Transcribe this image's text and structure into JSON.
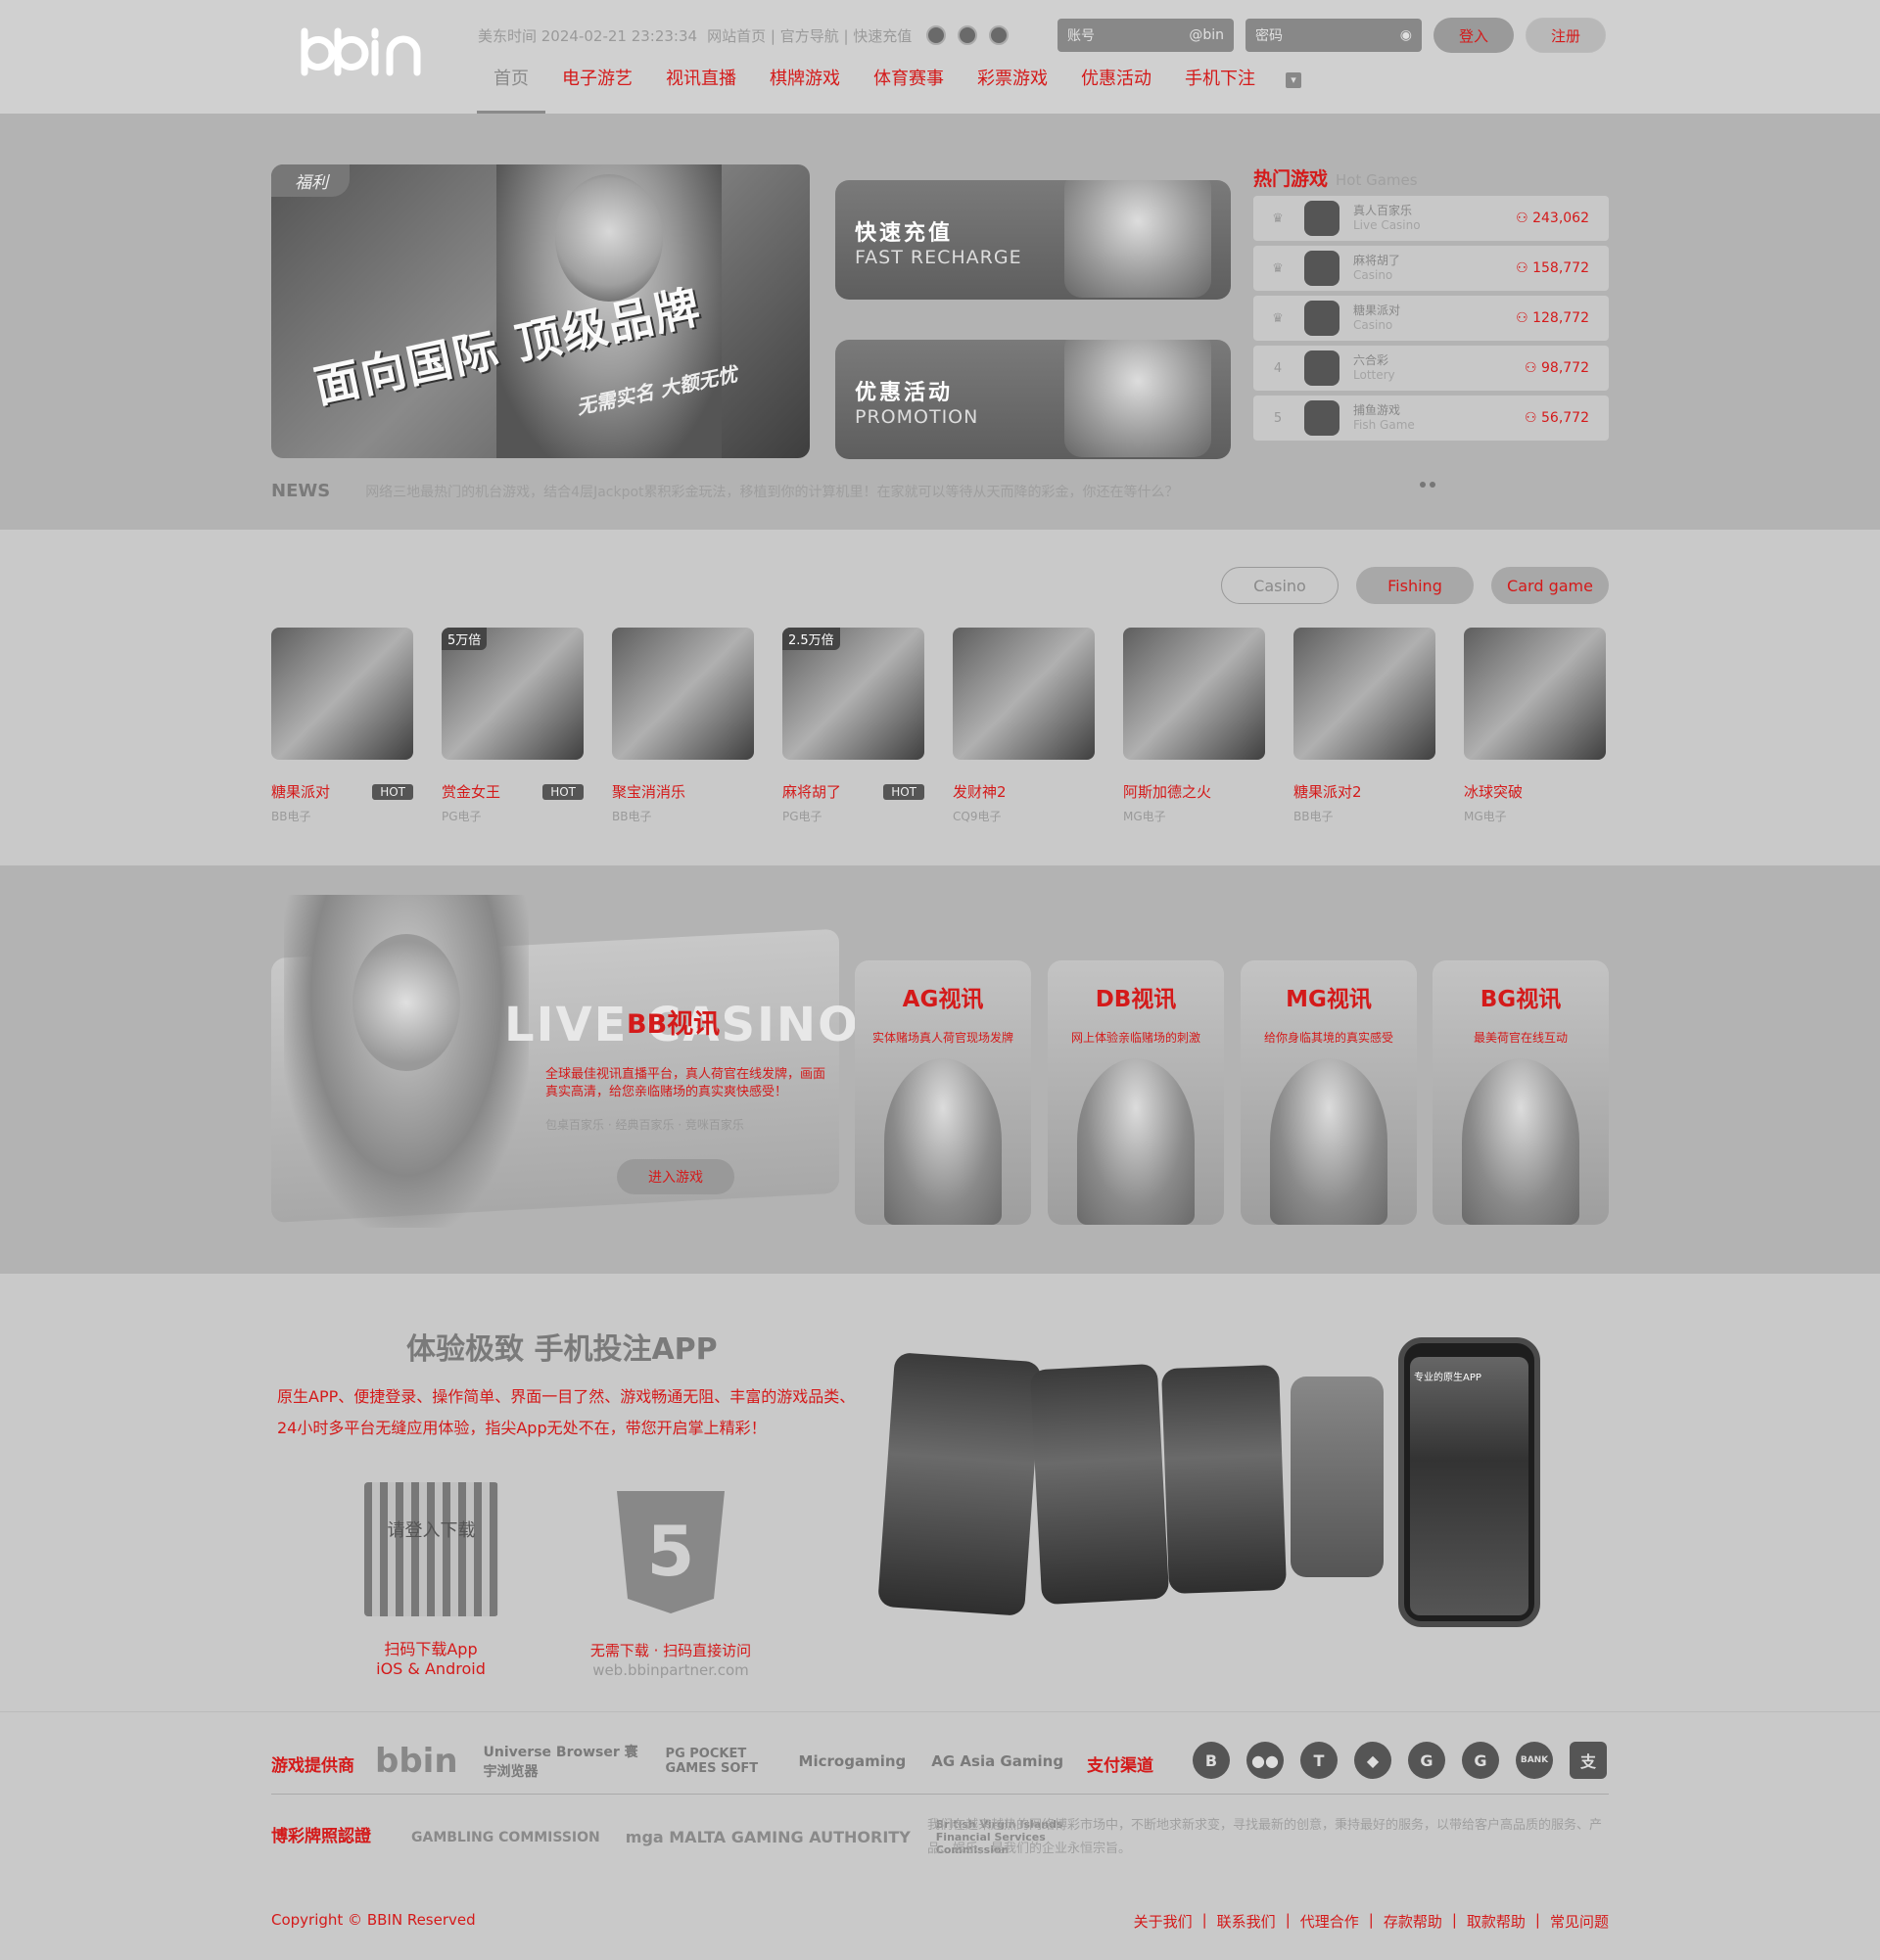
{
  "header": {
    "logo": "bbin",
    "datetime": "美东时间 2024-02-21 23:23:34",
    "links": [
      "网站首页",
      "官方导航",
      "快速充值"
    ],
    "flag_icons": [
      "flag-cn-icon",
      "flag-hk-icon",
      "flag-us-icon"
    ],
    "account_placeholder": "账号",
    "account_suffix": "@bin",
    "password_placeholder": "密码",
    "login_label": "登入",
    "register_label": "注册",
    "nav": [
      "首页",
      "电子游艺",
      "视讯直播",
      "棋牌游戏",
      "体育赛事",
      "彩票游戏",
      "优惠活动",
      "手机下注"
    ]
  },
  "hero": {
    "banner": {
      "tag": "福利",
      "title": "面向国际 顶级品牌",
      "subtitle": "无需实名 大额无忧"
    },
    "cards": [
      {
        "cn": "快速充值",
        "en": "FAST RECHARGE"
      },
      {
        "cn": "优惠活动",
        "en": "PROMOTION"
      }
    ],
    "hot_games": {
      "title": "热门游戏",
      "title_en": "Hot Games",
      "items": [
        {
          "rank": "1",
          "name": "真人百家乐",
          "category": "Live Casino",
          "count": "243,062"
        },
        {
          "rank": "2",
          "name": "麻将胡了",
          "category": "Casino",
          "count": "158,772"
        },
        {
          "rank": "3",
          "name": "糖果派对",
          "category": "Casino",
          "count": "128,772"
        },
        {
          "rank": "4",
          "name": "六合彩",
          "category": "Lottery",
          "count": "98,772"
        },
        {
          "rank": "5",
          "name": "捕鱼游戏",
          "category": "Fish Game",
          "count": "56,772"
        }
      ]
    },
    "news": {
      "label": "NEWS",
      "text": "网络三地最热门的机台游戏，结合4层Jackpot累积彩金玩法，移植到你的计算机里！在家就可以等待从天而降的彩金，你还在等什么？"
    }
  },
  "games": {
    "tabs": [
      "Casino",
      "Fishing",
      "Card game"
    ],
    "items": [
      {
        "name": "糖果派对",
        "provider": "BB电子",
        "badge": "",
        "hot": "HOT"
      },
      {
        "name": "赏金女王",
        "provider": "PG电子",
        "badge": "5万倍",
        "hot": "HOT"
      },
      {
        "name": "聚宝消消乐",
        "provider": "BB电子",
        "badge": "",
        "hot": ""
      },
      {
        "name": "麻将胡了",
        "provider": "PG电子",
        "badge": "2.5万倍",
        "hot": "HOT"
      },
      {
        "name": "发财神2",
        "provider": "CQ9电子",
        "badge": "",
        "hot": ""
      },
      {
        "name": "阿斯加德之火",
        "provider": "MG电子",
        "badge": "",
        "hot": ""
      },
      {
        "name": "糖果派对2",
        "provider": "BB电子",
        "badge": "",
        "hot": ""
      },
      {
        "name": "冰球突破",
        "provider": "MG电子",
        "badge": "",
        "hot": ""
      }
    ]
  },
  "live": {
    "bb": {
      "bg_text": "LIVE CASINO",
      "name": "BB视讯",
      "desc": "全球最佳视讯直播平台，真人荷官在线发牌，画面真实高清，给您亲临赌场的真实爽快感受！",
      "sub": "包桌百家乐 · 经典百家乐 · 竞咪百家乐",
      "button": "进入游戏"
    },
    "vendors": [
      {
        "name": "AG视讯",
        "desc": "实体赌场真人荷官现场发牌"
      },
      {
        "name": "DB视讯",
        "desc": "网上体验亲临赌场的刺激"
      },
      {
        "name": "MG视讯",
        "desc": "给你身临其境的真实感受"
      },
      {
        "name": "BG视讯",
        "desc": "最美荷官在线互动"
      }
    ]
  },
  "app": {
    "title": "体验极致 手机投注APP",
    "desc_1": "原生APP、便捷登录、操作简单、界面一目了然、游戏畅通无阻、丰富的游戏品类、",
    "desc_2": "24小时多平台无缝应用体验，指尖App无处不在，带您开启掌上精彩！",
    "qr_overlay": "请登入下载",
    "qr_label_1": "扫码下载App",
    "qr_label_2": "iOS & Android",
    "h5_label": "无需下载 · 扫码直接访问",
    "h5_url": "web.bbinpartner.com",
    "phone_screen_title": "专业的原生APP"
  },
  "footer": {
    "providers_label": "游戏提供商",
    "providers": [
      "bbin",
      "Universe Browser 寰宇浏览器",
      "PG POCKET GAMES SOFT",
      "Microgaming",
      "AG Asia Gaming"
    ],
    "payment_label": "支付渠道",
    "payments": [
      "B",
      "●●",
      "T",
      "◆",
      "G",
      "G",
      "BANK",
      "支"
    ],
    "license_label": "博彩牌照認證",
    "licenses": [
      "GAMBLING COMMISSION",
      "mga MALTA GAMING AUTHORITY",
      "British Virgin Islands Financial Services Commission"
    ],
    "about": "我们在越来越热的网络博彩市场中，不断地求新求变，寻找最新的创意，秉持最好的服务，以带给客户高品质的服务、产品、娱乐，是我们的企业永恒宗旨。",
    "copyright": "Copyright © BBIN Reserved",
    "links": [
      "关于我们",
      "联系我们",
      "代理合作",
      "存款帮助",
      "取款帮助",
      "常见问题"
    ]
  }
}
